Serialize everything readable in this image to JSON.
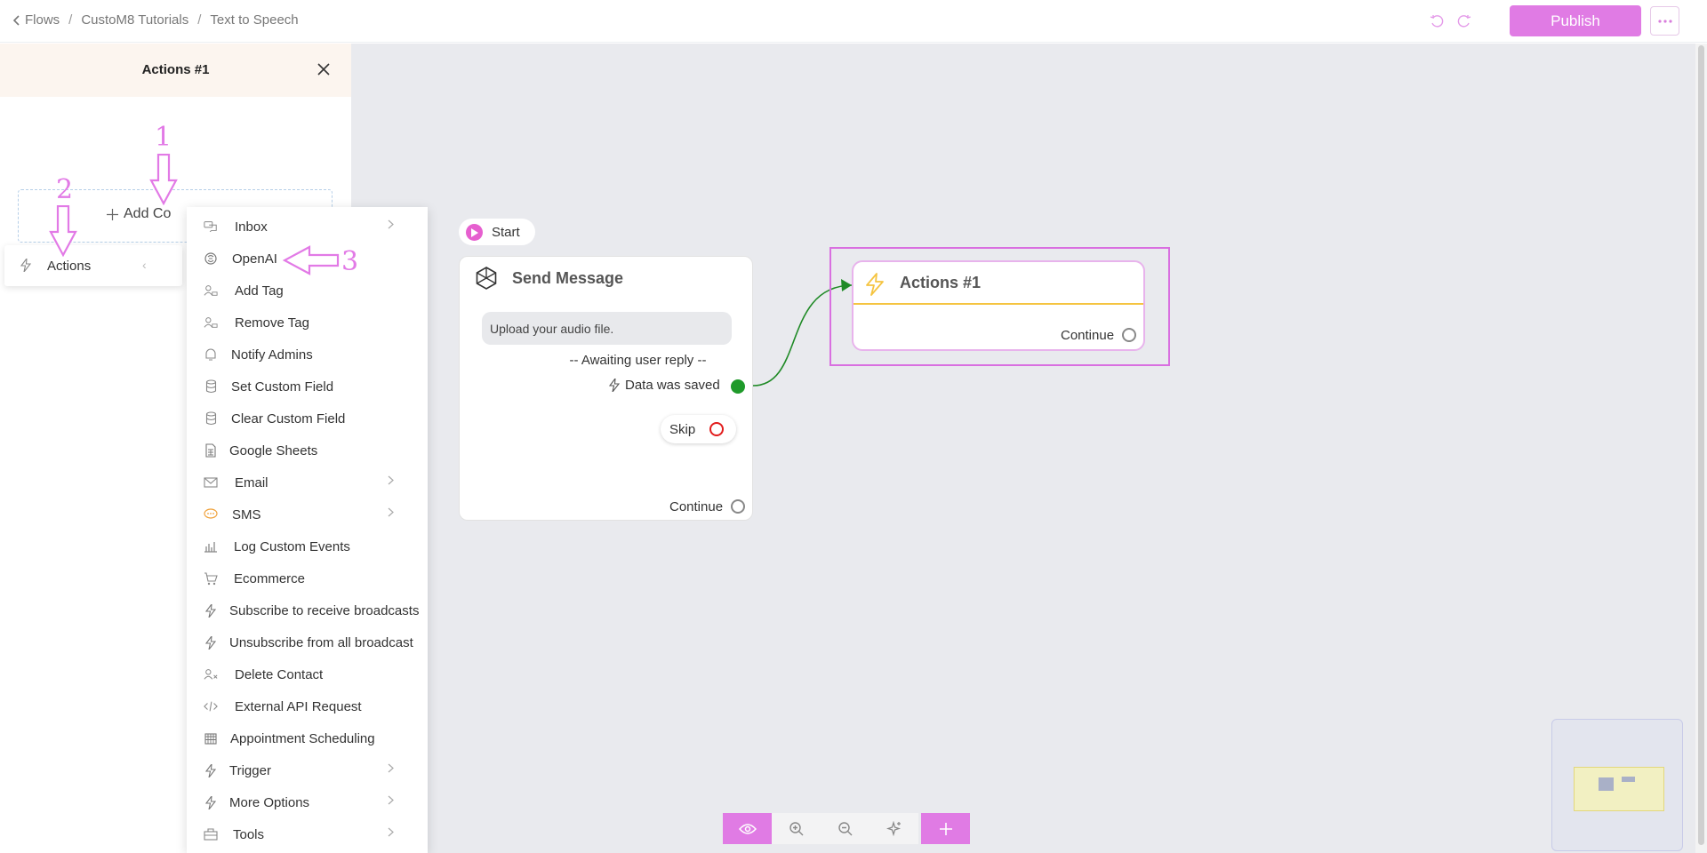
{
  "header": {
    "breadcrumb": [
      "Flows",
      "CustoM8 Tutorials",
      "Text to Speech"
    ],
    "publish_label": "Publish"
  },
  "panel": {
    "title": "Actions #1",
    "add_content_label": "Add Co",
    "actions_label": "Actions"
  },
  "menu": {
    "items": [
      {
        "label": "Inbox",
        "icon": "chat-icon",
        "submenu": true
      },
      {
        "label": "OpenAI",
        "icon": "openai-icon",
        "submenu": false
      },
      {
        "label": "Add Tag",
        "icon": "user-tag-icon",
        "submenu": false
      },
      {
        "label": "Remove Tag",
        "icon": "user-tag-icon",
        "submenu": false
      },
      {
        "label": "Notify Admins",
        "icon": "bell-icon",
        "submenu": false
      },
      {
        "label": "Set Custom Field",
        "icon": "database-icon",
        "submenu": false
      },
      {
        "label": "Clear Custom Field",
        "icon": "database-icon",
        "submenu": false
      },
      {
        "label": "Google Sheets",
        "icon": "sheet-icon",
        "submenu": false
      },
      {
        "label": "Email",
        "icon": "mail-icon",
        "submenu": true
      },
      {
        "label": "SMS",
        "icon": "sms-icon",
        "submenu": true
      },
      {
        "label": "Log Custom Events",
        "icon": "chart-icon",
        "submenu": false
      },
      {
        "label": "Ecommerce",
        "icon": "cart-icon",
        "submenu": false
      },
      {
        "label": "Subscribe to receive broadcasts",
        "icon": "bolt-icon",
        "submenu": false
      },
      {
        "label": "Unsubscribe from all broadcast",
        "icon": "bolt-icon",
        "submenu": false
      },
      {
        "label": "Delete Contact",
        "icon": "user-x-icon",
        "submenu": false
      },
      {
        "label": "External API Request",
        "icon": "code-icon",
        "submenu": false
      },
      {
        "label": "Appointment Scheduling",
        "icon": "calendar-icon",
        "submenu": false
      },
      {
        "label": "Trigger",
        "icon": "bolt-icon",
        "submenu": true
      },
      {
        "label": "More Options",
        "icon": "bolt-icon",
        "submenu": true
      },
      {
        "label": "Tools",
        "icon": "toolbox-icon",
        "submenu": true
      }
    ]
  },
  "annotations": [
    "1",
    "2",
    "3"
  ],
  "flow": {
    "start_label": "Start",
    "send_message": {
      "title": "Send Message",
      "message": "Upload your audio file.",
      "awaiting": "-- Awaiting user reply --",
      "saved_label": "Data was saved",
      "skip_label": "Skip",
      "continue_label": "Continue"
    },
    "actions_node": {
      "title": "Actions #1",
      "continue_label": "Continue"
    }
  },
  "colors": {
    "accent": "#e07be4",
    "saved": "#1f9a2a",
    "skip": "#e21c1c",
    "actions_bar": "#f5c441"
  }
}
